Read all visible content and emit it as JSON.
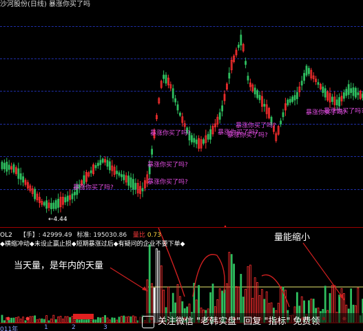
{
  "window": {
    "title": "沙河股份(日线) 暴涨你买了吗"
  },
  "price_panel": {
    "low_label": "←4.44",
    "signal_labels": [
      "暴涨你买了吗?",
      "暴涨你买了吗?",
      "暴涨你买了吗?",
      "暴涨你买了吗?",
      "暴涨你买了吗?",
      "暴涨你买了吗?",
      "暴涨你买了吗?",
      "暴涨你买了吗?",
      "暴涨你买了吗?"
    ]
  },
  "volume_info": {
    "indicator": "OL2",
    "unit": "【手】:",
    "value": "42999.49",
    "std_label": "标准:",
    "std_value": "195030.86",
    "ratio_label": "量比",
    "ratio_value": "0.73",
    "legend": "◆横缩冲动◆未设止赢止损◆短期暴涨过后◆有疑问的企业不要下单◆"
  },
  "annotations": {
    "left": "当天量，是年内的天量",
    "right": "量能缩小"
  },
  "x_axis": {
    "labels": [
      "011年",
      "1",
      "2",
      "3"
    ]
  },
  "watermark": {
    "text": "关注微信 \"老韩实盘\" 回复 \"指标\" 免费领"
  },
  "colors": {
    "background": "#000000",
    "grid": "#1f2fa8",
    "up": "#ff3030",
    "down": "#2fbf5f",
    "label": "#e24de2",
    "annotation_arrow": "#d02020"
  }
}
